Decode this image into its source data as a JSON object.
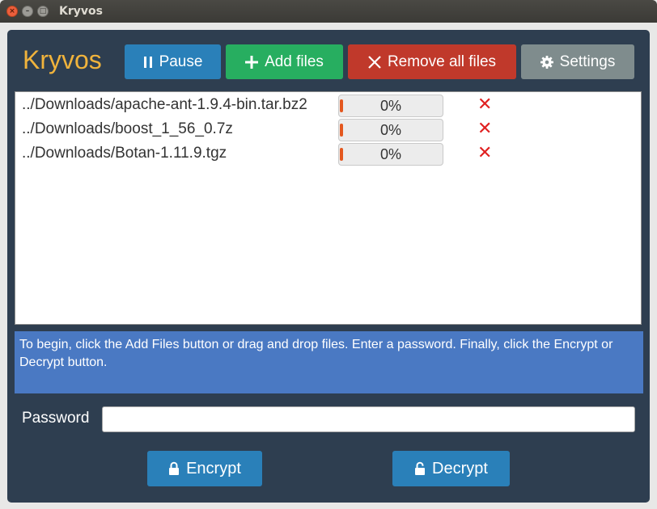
{
  "window": {
    "title": "Kryvos",
    "close_glyph": "×",
    "minimize_glyph": "–",
    "maximize_glyph": "□"
  },
  "app": {
    "brand": "Kryvos",
    "colors": {
      "background": "#2e3e50",
      "brand": "#f0b33c",
      "pause": "#2a80b9",
      "add": "#27ae60",
      "remove": "#c0392b",
      "settings": "#7f8c8d",
      "status": "#4a79c3",
      "remove_icon": "#e02020",
      "progress_fill": "#e4581f"
    }
  },
  "toolbar": {
    "pause": {
      "label": "Pause",
      "icon": "pause-icon"
    },
    "add_files": {
      "label": "Add files",
      "icon": "plus-icon"
    },
    "remove_all": {
      "label": "Remove all files",
      "icon": "close-icon"
    },
    "settings": {
      "label": "Settings",
      "icon": "gear-icon"
    }
  },
  "files": [
    {
      "name": "../Downloads/apache-ant-1.9.4-bin.tar.bz2",
      "progress_text": "0%",
      "progress": 0,
      "remove_glyph": "✕"
    },
    {
      "name": "../Downloads/boost_1_56_0.7z",
      "progress_text": "0%",
      "progress": 0,
      "remove_glyph": "✕"
    },
    {
      "name": "../Downloads/Botan-1.11.9.tgz",
      "progress_text": "0%",
      "progress": 0,
      "remove_glyph": "✕"
    }
  ],
  "status": {
    "message": "To begin, click the Add Files button or drag and drop files. Enter a password. Finally, click the Encrypt or Decrypt button."
  },
  "password": {
    "label": "Password",
    "value": "",
    "placeholder": ""
  },
  "actions": {
    "encrypt": {
      "label": "Encrypt",
      "icon": "lock-icon"
    },
    "decrypt": {
      "label": "Decrypt",
      "icon": "unlock-icon"
    }
  }
}
